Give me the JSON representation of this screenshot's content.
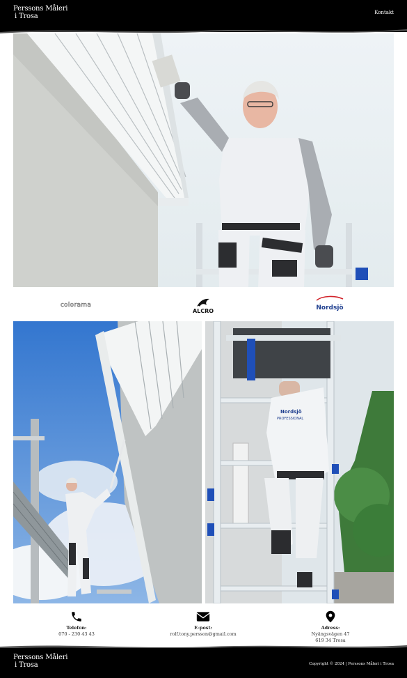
{
  "header": {
    "logo_line1": "Perssons Måleri",
    "logo_line2": "i Trosa",
    "nav_contact": "Kontakt"
  },
  "brands": {
    "left": "colorama",
    "center": "ALCRO",
    "right": "Nordsjö"
  },
  "photo_text": {
    "shirt_brand": "Nordsjö",
    "shirt_sub": "PROFESSIONAL"
  },
  "contact": {
    "phone_label": "Telefon:",
    "phone_value": "070 - 230 43 43",
    "email_label": "E-post:",
    "email_value": "rolf.tony.persson@gmail.com",
    "address_label": "Adress:",
    "address_line1": "Nyängsvägen 47",
    "address_line2": "619 34 Trosa"
  },
  "footer": {
    "logo_line1": "Perssons Måleri",
    "logo_line2": "i Trosa",
    "copyright": "Copyright © 2024 | Perssons Måleri i Trosa"
  },
  "colors": {
    "header_bg": "#000000",
    "nordsjo_blue": "#1f3f8f",
    "nordsjo_red": "#d2232a",
    "sky": "#3d7fd1"
  }
}
